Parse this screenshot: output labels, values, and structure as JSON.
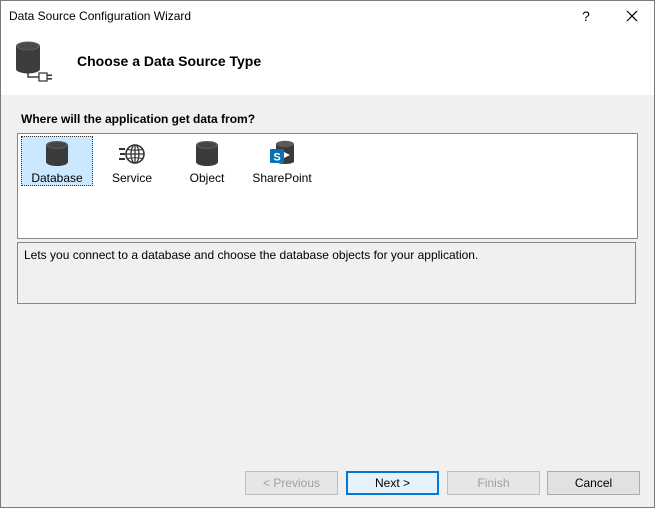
{
  "window": {
    "title": "Data Source Configuration Wizard",
    "help_label": "?",
    "close_icon": "close-icon"
  },
  "header": {
    "title": "Choose a Data Source Type",
    "icon": "database-plug-icon"
  },
  "main": {
    "prompt": "Where will the application get data from?",
    "types": [
      {
        "label": "Database",
        "icon": "database-icon",
        "selected": true
      },
      {
        "label": "Service",
        "icon": "service-globe-icon",
        "selected": false
      },
      {
        "label": "Object",
        "icon": "object-cylinder-icon",
        "selected": false
      },
      {
        "label": "SharePoint",
        "icon": "sharepoint-icon",
        "selected": false
      }
    ],
    "description": "Lets you connect to a database and choose the database objects for your application."
  },
  "buttons": {
    "previous": "< Previous",
    "next": "Next >",
    "finish": "Finish",
    "cancel": "Cancel"
  },
  "colors": {
    "selection_bg": "#cce8ff",
    "accent": "#0078d7",
    "panel_bg": "#f0f0f0",
    "sharepoint_blue": "#0a6fb5"
  }
}
